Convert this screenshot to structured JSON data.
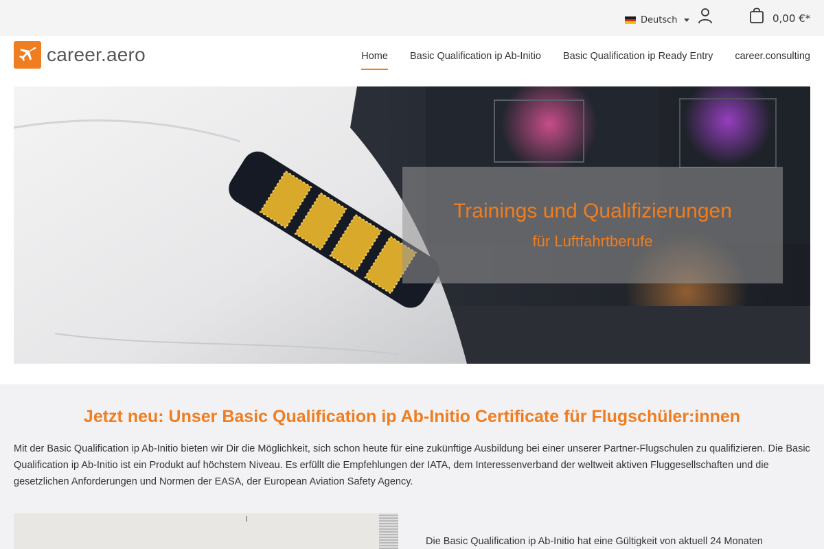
{
  "topbar": {
    "language_label": "Deutsch",
    "cart_total": "0,00 €*",
    "icons": {
      "flag": "germany-flag-icon",
      "caret": "chevron-down-icon",
      "user": "user-icon",
      "cart": "shopping-bag-icon"
    }
  },
  "header": {
    "logo_text": "career.aero",
    "logo_icon": "airplane-icon",
    "nav": [
      {
        "label": "Home",
        "active": true
      },
      {
        "label": "Basic Qualification ip Ab-Initio",
        "active": false
      },
      {
        "label": "Basic Qualification ip Ready Entry",
        "active": false
      },
      {
        "label": "career.consulting",
        "active": false
      }
    ]
  },
  "hero": {
    "title": "Trainings und Qualifizierungen",
    "subtitle": "für Luftfahrtberufe"
  },
  "main": {
    "headline": "Jetzt neu: Unser Basic Qualification ip Ab-Initio Certificate für Flugschüler:innen",
    "intro_text": "Mit der Basic Qualification ip Ab-Initio bieten wir Dir die Möglichkeit, sich schon heute für eine zukünftige Ausbildung bei einer unserer Partner-Flugschulen zu qualifizieren. Die Basic Qualification ip Ab-Initio ist ein Produkt auf höchstem Niveau. Es erfüllt die Empfehlungen der IATA, dem Interessenverband der weltweit aktiven Fluggesellschaften und die gesetzlichen Anforderungen und Normen der EASA, der European Aviation Safety Agency.",
    "side_text": "Die Basic Qualification ip Ab-Initio hat eine Gültigkeit von aktuell 24 Monaten"
  },
  "colors": {
    "accent": "#f07d1f",
    "text": "#333333",
    "background": "#f2f2f4"
  }
}
